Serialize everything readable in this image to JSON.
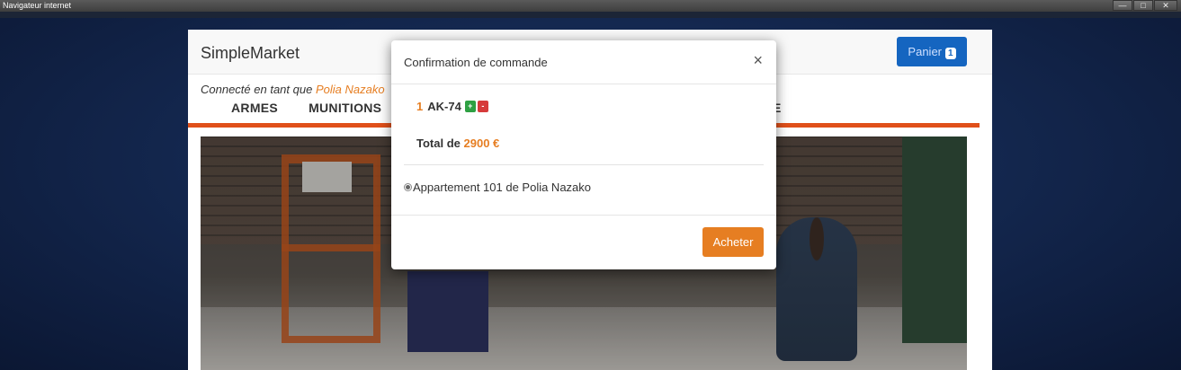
{
  "window": {
    "title": "Navigateur internet",
    "minimize": "—",
    "maximize": "□",
    "close": "✕"
  },
  "site": {
    "brand": "SimpleMarket",
    "cart_label": "Panier",
    "cart_count": "1",
    "logged_prefix": "Connecté en tant que",
    "logged_user": "Polia Nazako",
    "menu": [
      "ARMES",
      "MUNITIONS"
    ],
    "menu_partial": "E"
  },
  "modal": {
    "title": "Confirmation de commande",
    "close": "×",
    "item": {
      "quantity": "1",
      "name": "AK-74",
      "plus": "+",
      "minus": "-"
    },
    "total_label": "Total de",
    "total_amount": "2900 €",
    "address": "Appartement 101 de Polia Nazako",
    "buy_label": "Acheter"
  },
  "colors": {
    "accent": "#e67e22",
    "brand_blue": "#1565c0",
    "nav_bar": "#e0501a",
    "plus": "#2ea043",
    "minus": "#d63a3a"
  },
  "icons": {
    "close": "close-icon",
    "radio": "radio-selected-icon"
  }
}
